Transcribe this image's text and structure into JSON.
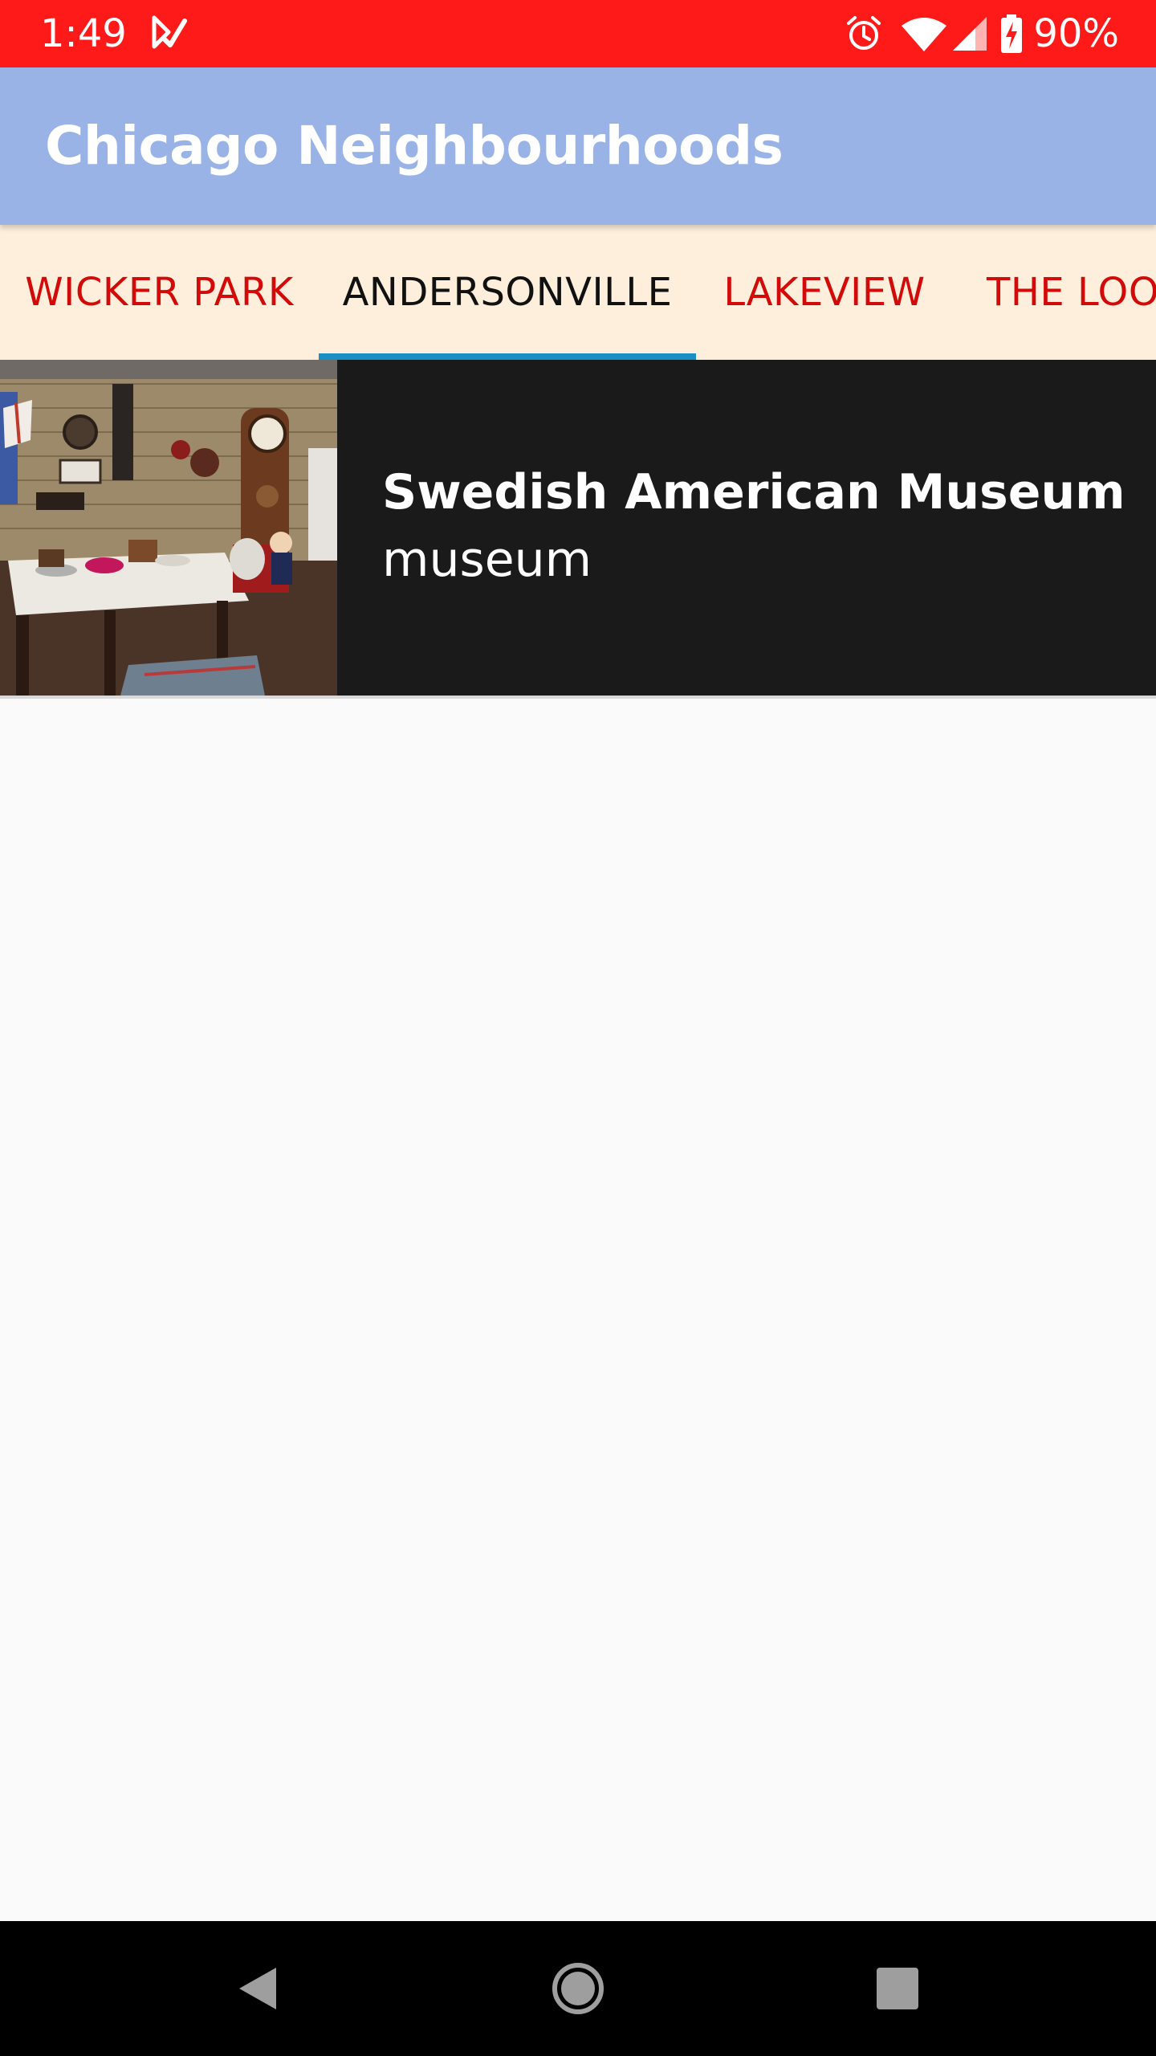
{
  "status_bar": {
    "time": "1:49",
    "battery_percent": "90%",
    "icons": [
      "app-notification-icon",
      "alarm-icon",
      "wifi-icon",
      "cellular-signal-icon",
      "battery-charging-icon"
    ],
    "background_color": "#ff1a1a"
  },
  "app_bar": {
    "title": "Chicago Neighbourhoods",
    "background_color": "#99b3e6"
  },
  "tabs": {
    "items": [
      {
        "label": "WICKER PARK",
        "selected": false
      },
      {
        "label": "ANDERSONVILLE",
        "selected": true
      },
      {
        "label": "LAKEVIEW",
        "selected": false
      },
      {
        "label": "THE LOOP",
        "selected": false
      }
    ],
    "background_color": "#fdefdc",
    "text_color": "#d20a0a",
    "selected_text_color": "#111111",
    "indicator_color": "#1a8fc4"
  },
  "list": {
    "items": [
      {
        "title": "Swedish American Museum",
        "subtitle": "museum",
        "thumbnail": "museum-interior-photo"
      }
    ],
    "item_background_color": "#1a1a1a"
  },
  "nav_bar": {
    "buttons": [
      "back-icon",
      "home-icon",
      "recents-icon"
    ]
  }
}
